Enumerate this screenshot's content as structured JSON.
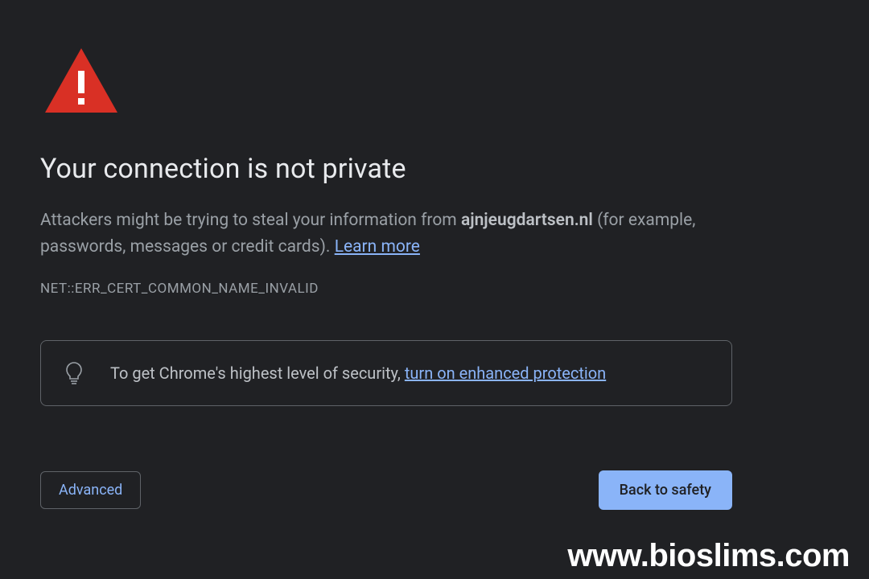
{
  "heading": "Your connection is not private",
  "description": {
    "prefix": "Attackers might be trying to steal your information from ",
    "domain": "ajnjeugdartsen.nl",
    "suffix": " (for example, passwords, messages or credit cards). ",
    "learn_more": "Learn more"
  },
  "error_code": "NET::ERR_CERT_COMMON_NAME_INVALID",
  "tip": {
    "prefix": "To get Chrome's highest level of security, ",
    "link": "turn on enhanced protection"
  },
  "buttons": {
    "advanced": "Advanced",
    "back": "Back to safety"
  },
  "watermark": "www.bioslims.com"
}
